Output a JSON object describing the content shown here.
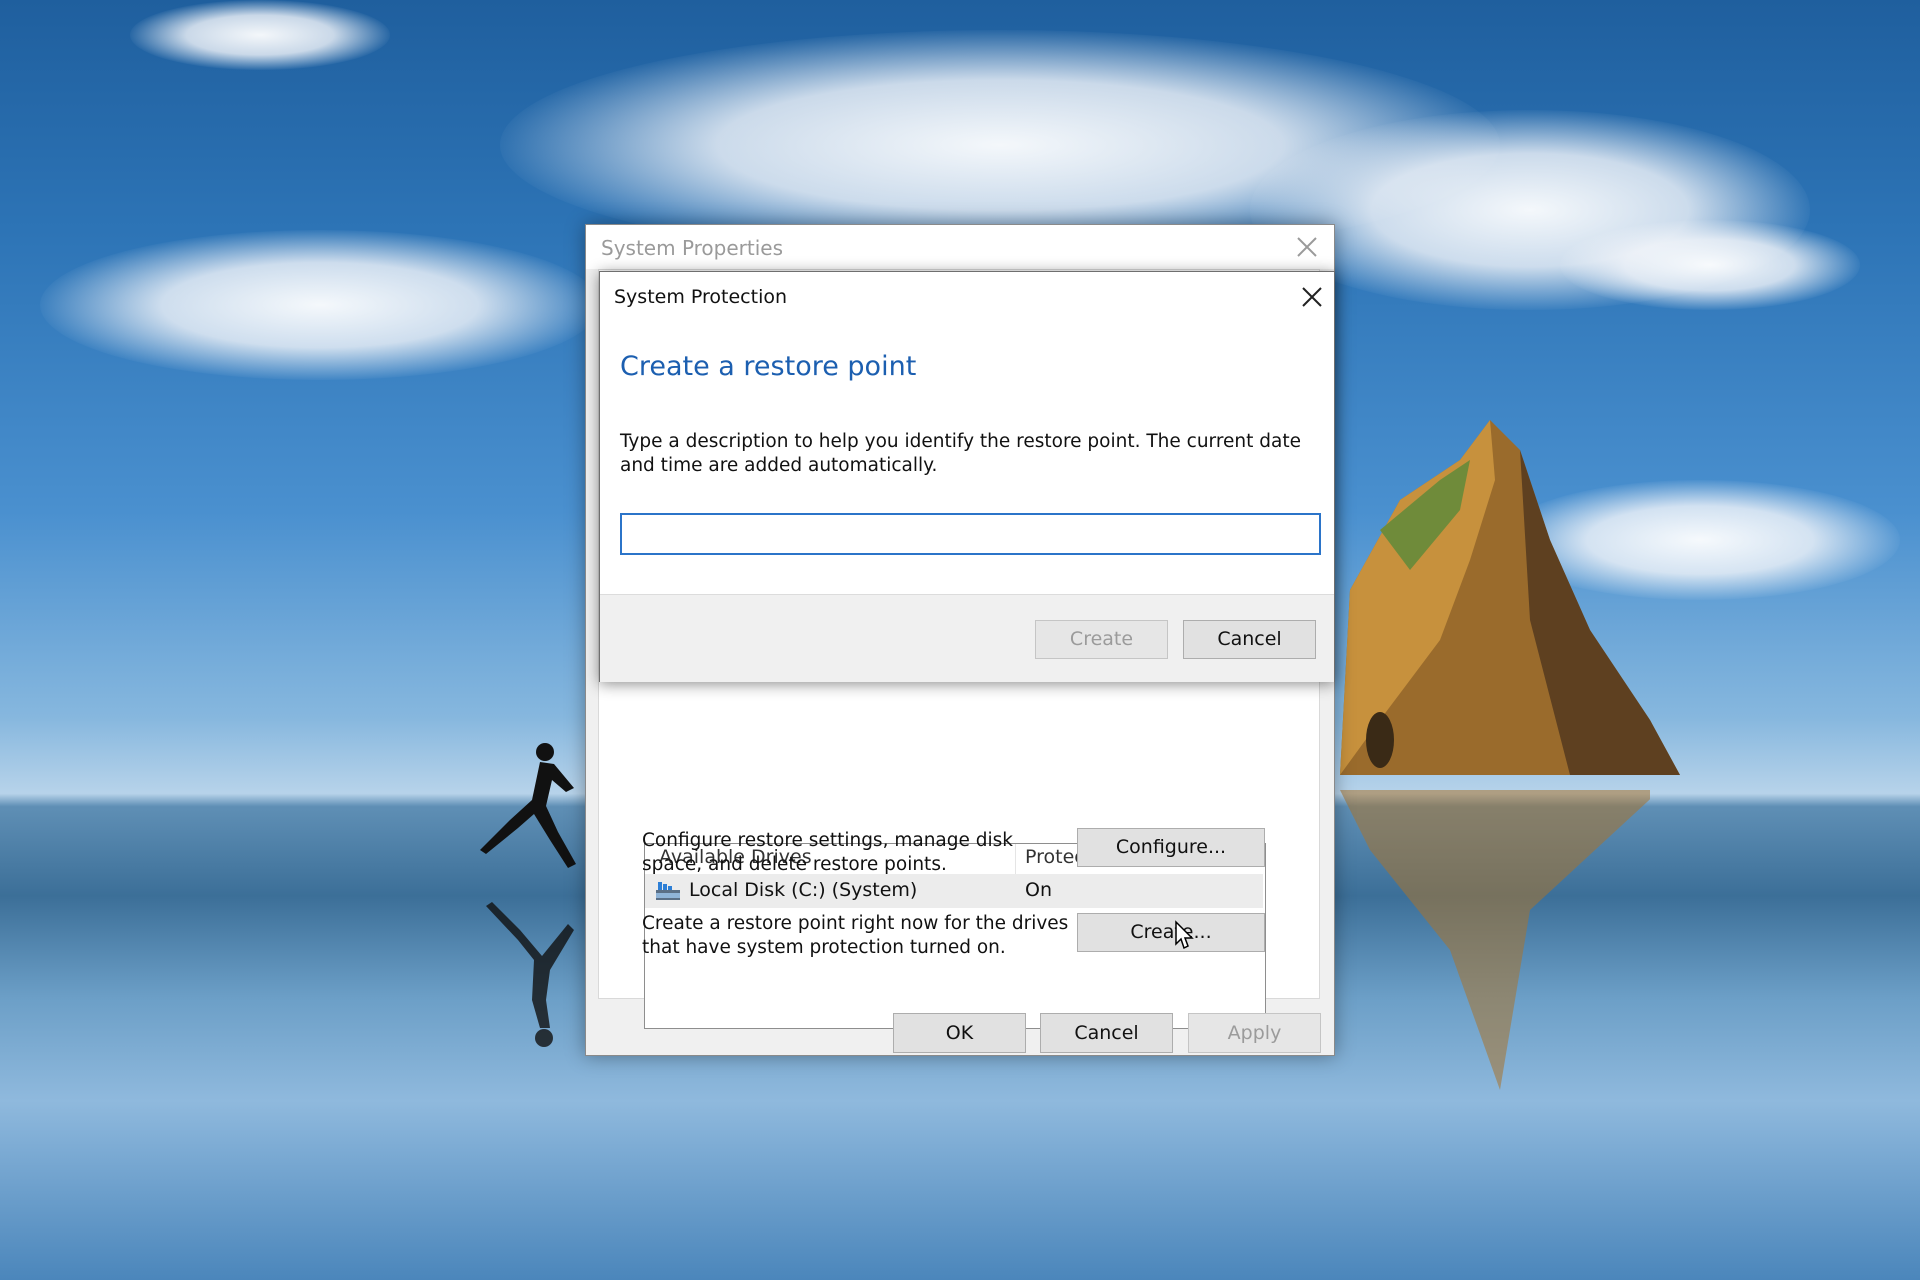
{
  "sysprops": {
    "title": "System Properties",
    "drives_table": {
      "col_drives": "Available Drives",
      "col_protection": "Protection",
      "rows": [
        {
          "name": "Local Disk (C:) (System)",
          "protection": "On"
        }
      ]
    },
    "configure_desc": "Configure restore settings, manage disk space, and delete restore points.",
    "configure_label": "Configure...",
    "create_desc": "Create a restore point right now for the drives that have system protection turned on.",
    "create_label": "Create...",
    "ok_label": "OK",
    "cancel_label": "Cancel",
    "apply_label": "Apply"
  },
  "sysprot": {
    "caption": "System Protection",
    "heading": "Create a restore point",
    "instruction": "Type a description to help you identify the restore point. The current date and time are added automatically.",
    "input_value": "",
    "create_label": "Create",
    "cancel_label": "Cancel"
  },
  "colors": {
    "accent": "#1c5fb0",
    "input_border": "#2b74c9"
  },
  "icons": [
    "close-icon",
    "drive-icon",
    "mouse-pointer-icon"
  ]
}
